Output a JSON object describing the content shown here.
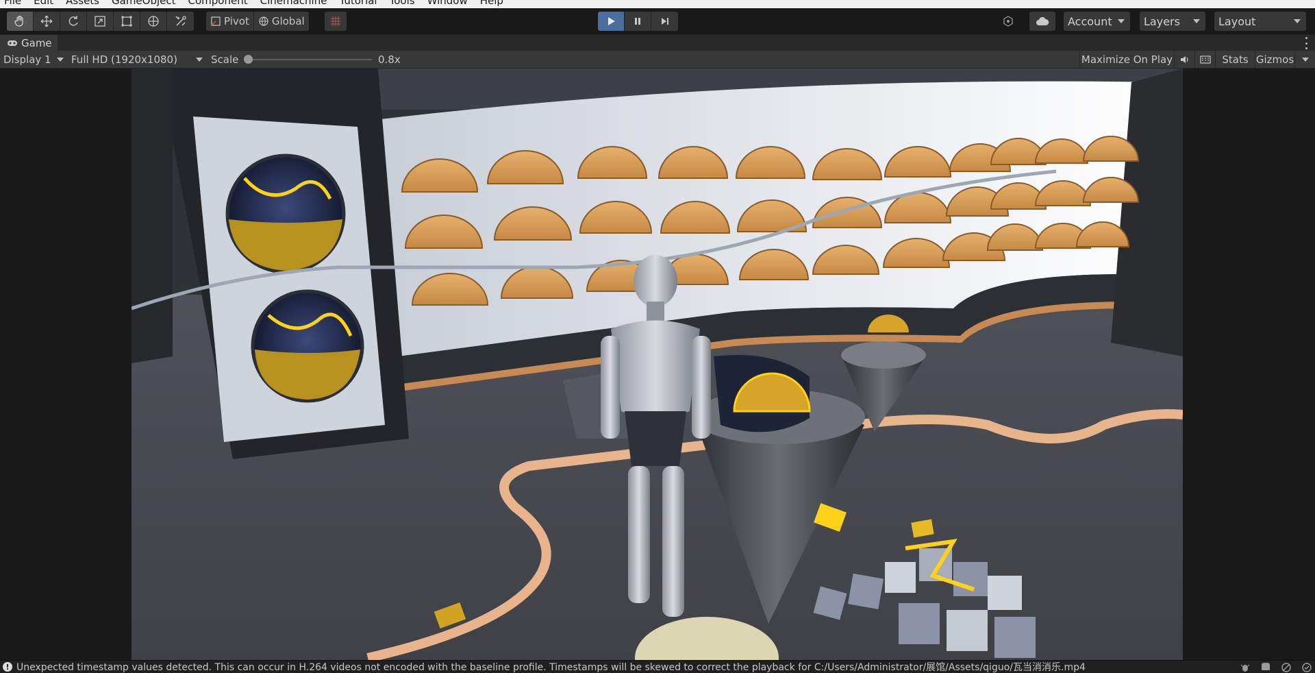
{
  "menu": {
    "items": [
      "File",
      "Edit",
      "Assets",
      "GameObject",
      "Component",
      "Cinemachine",
      "Tutorial",
      "Tools",
      "Window",
      "Help"
    ]
  },
  "toolbar": {
    "tools": [
      "hand-tool-icon",
      "move-tool-icon",
      "rotate-tool-icon",
      "scale-tool-icon",
      "rect-tool-icon",
      "transform-tool-icon",
      "custom-tool-icon"
    ],
    "pivot_label": "Pivot",
    "global_label": "Global",
    "account_label": "Account",
    "layers_label": "Layers",
    "layout_label": "Layout"
  },
  "game_tab": {
    "label": "Game"
  },
  "game_toolbar": {
    "display": "Display 1",
    "resolution": "Full HD (1920x1080)",
    "scale_label": "Scale",
    "scale_value": "0.8x",
    "maximize_label": "Maximize On Play",
    "stats_label": "Stats",
    "gizmos_label": "Gizmos"
  },
  "status": {
    "message": "Unexpected timestamp values detected. This can occur in H.264 videos not encoded with the baseline profile. Timestamps will be skewed to correct the playback for C:/Users/Administrator/展馆/Assets/qiguo/瓦当消消乐.mp4"
  },
  "colors": {
    "accent_play": "#4a6f9f",
    "panel": "#383838",
    "background": "#191919",
    "gold": "#d9a15a"
  }
}
